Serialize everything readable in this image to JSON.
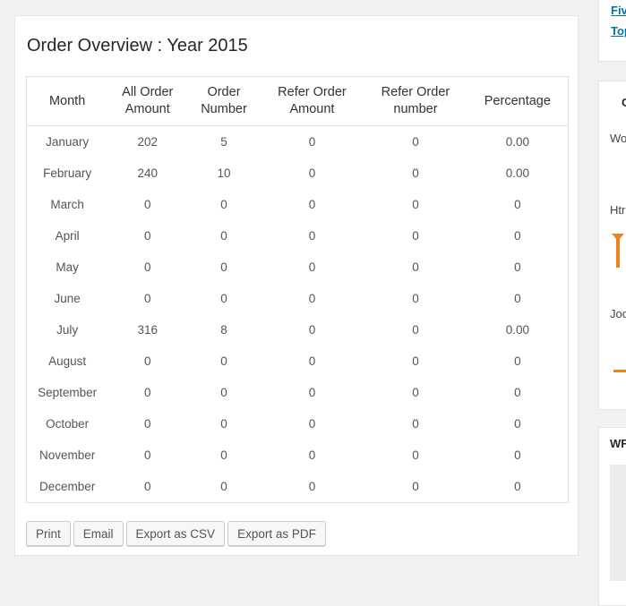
{
  "panel": {
    "title": "Order Overview : Year 2015",
    "columns": [
      "Month",
      "All Order Amount",
      "Order Number",
      "Refer Order Amount",
      "Refer Order number",
      "Percentage"
    ],
    "column_lines": [
      [
        "Month"
      ],
      [
        "All Order",
        "Amount"
      ],
      [
        "Order",
        "Number"
      ],
      [
        "Refer Order",
        "Amount"
      ],
      [
        "Refer Order",
        "number"
      ],
      [
        "Percentage"
      ]
    ],
    "rows": [
      [
        "January",
        "202",
        "5",
        "0",
        "0",
        "0.00"
      ],
      [
        "February",
        "240",
        "10",
        "0",
        "0",
        "0.00"
      ],
      [
        "March",
        "0",
        "0",
        "0",
        "0",
        "0"
      ],
      [
        "April",
        "0",
        "0",
        "0",
        "0",
        "0"
      ],
      [
        "May",
        "0",
        "0",
        "0",
        "0",
        "0"
      ],
      [
        "June",
        "0",
        "0",
        "0",
        "0",
        "0"
      ],
      [
        "July",
        "316",
        "8",
        "0",
        "0",
        "0.00"
      ],
      [
        "August",
        "0",
        "0",
        "0",
        "0",
        "0"
      ],
      [
        "September",
        "0",
        "0",
        "0",
        "0",
        "0"
      ],
      [
        "October",
        "0",
        "0",
        "0",
        "0",
        "0"
      ],
      [
        "November",
        "0",
        "0",
        "0",
        "0",
        "0"
      ],
      [
        "December",
        "0",
        "0",
        "0",
        "0",
        "0"
      ]
    ],
    "buttons": {
      "print": "Print",
      "email": "Email",
      "export_csv": "Export as CSV",
      "export_pdf": "Export as PDF"
    }
  },
  "sidebar": {
    "links": [
      "Fiv",
      "Top"
    ],
    "box2_heading": "C",
    "box2_items": [
      "Wo",
      "Htr",
      "Joo"
    ],
    "box3_heading": "WF"
  },
  "colors": {
    "link": "#0073aa",
    "accent": "#f0821e",
    "page_bg": "#f1f1f1"
  }
}
